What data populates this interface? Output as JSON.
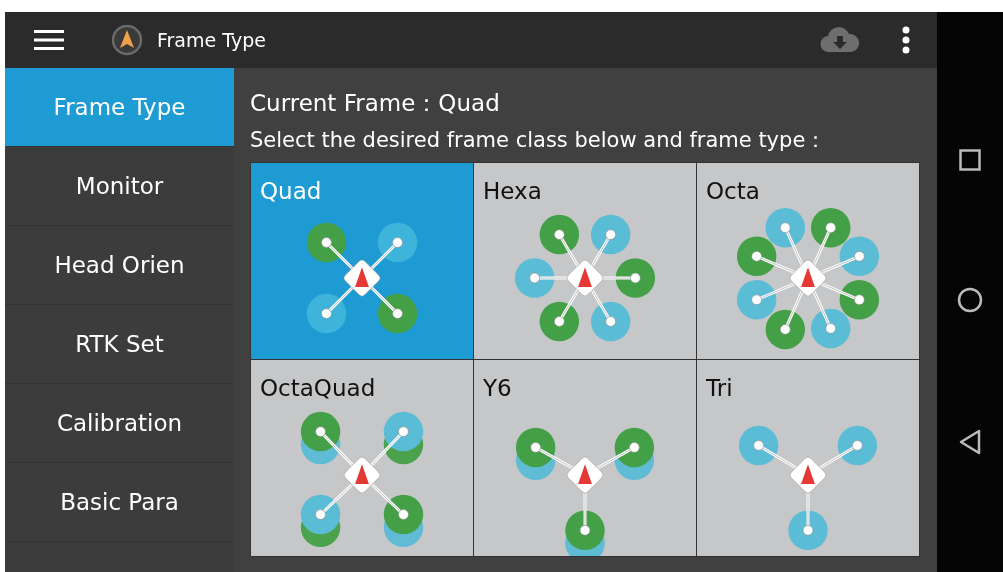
{
  "app_bar": {
    "title": "Frame Type"
  },
  "sidebar": {
    "items": [
      {
        "label": "Frame Type",
        "selected": true
      },
      {
        "label": "Monitor",
        "selected": false
      },
      {
        "label": "Head Orien",
        "selected": false
      },
      {
        "label": "RTK Set",
        "selected": false
      },
      {
        "label": "Calibration",
        "selected": false
      },
      {
        "label": "Basic Para",
        "selected": false
      }
    ]
  },
  "current_frame": {
    "label": "Current Frame：",
    "value": "Quad"
  },
  "instruction": "Select the desired frame class below and frame type：",
  "frames": [
    {
      "label": "Quad",
      "kind": "quad",
      "selected": true
    },
    {
      "label": "Hexa",
      "kind": "hexa",
      "selected": false
    },
    {
      "label": "Octa",
      "kind": "octa",
      "selected": false
    },
    {
      "label": "OctaQuad",
      "kind": "octaquad",
      "selected": false
    },
    {
      "label": "Y6",
      "kind": "y6",
      "selected": false
    },
    {
      "label": "Tri",
      "kind": "tri",
      "selected": false
    }
  ]
}
